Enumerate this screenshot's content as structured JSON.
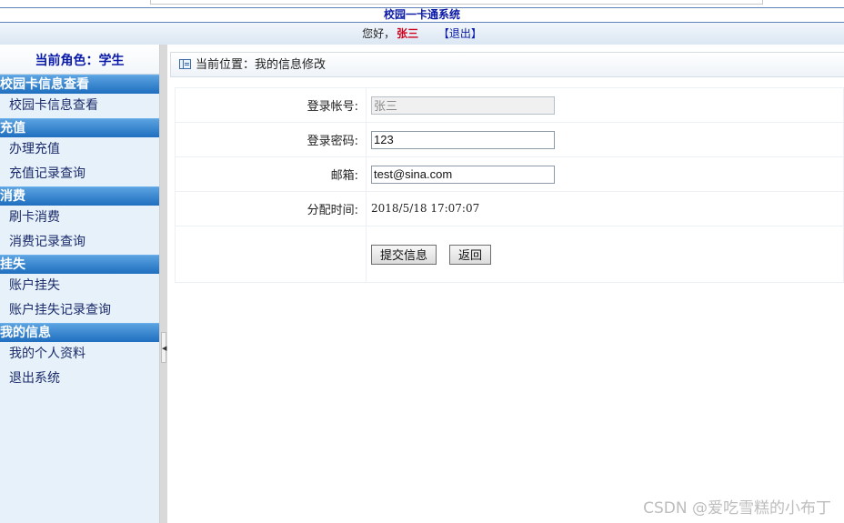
{
  "header": {
    "system_title": "校园一卡通系统",
    "greeting": "您好，",
    "username": "张三",
    "logout_label": "【退出】"
  },
  "sidebar": {
    "role_label": "当前角色：学生",
    "groups": [
      {
        "title": "校园卡信息查看",
        "items": [
          "校园卡信息查看"
        ]
      },
      {
        "title": "充值",
        "items": [
          "办理充值",
          "充值记录查询"
        ]
      },
      {
        "title": "消费",
        "items": [
          "刷卡消费",
          "消费记录查询"
        ]
      },
      {
        "title": "挂失",
        "items": [
          "账户挂失",
          "账户挂失记录查询"
        ]
      },
      {
        "title": "我的信息",
        "items": [
          "我的个人资料",
          "退出系统"
        ]
      }
    ],
    "collapse_glyph": "◀"
  },
  "main": {
    "breadcrumb": "当前位置：我的信息修改",
    "form": {
      "account_label": "登录帐号:",
      "account_value": "张三",
      "password_label": "登录密码:",
      "password_value": "123",
      "email_label": "邮箱:",
      "email_value": "test@sina.com",
      "assign_time_label": "分配时间:",
      "assign_time_value": "2018/5/18 17:07:07",
      "submit_label": "提交信息",
      "back_label": "返回"
    }
  },
  "watermark": "CSDN @爱吃雪糕的小布丁",
  "colors": {
    "title": "#0a1aa8",
    "username": "#d0021b",
    "group_header": "#1f6fc0",
    "sidebar_bg": "#e7f1f9"
  }
}
